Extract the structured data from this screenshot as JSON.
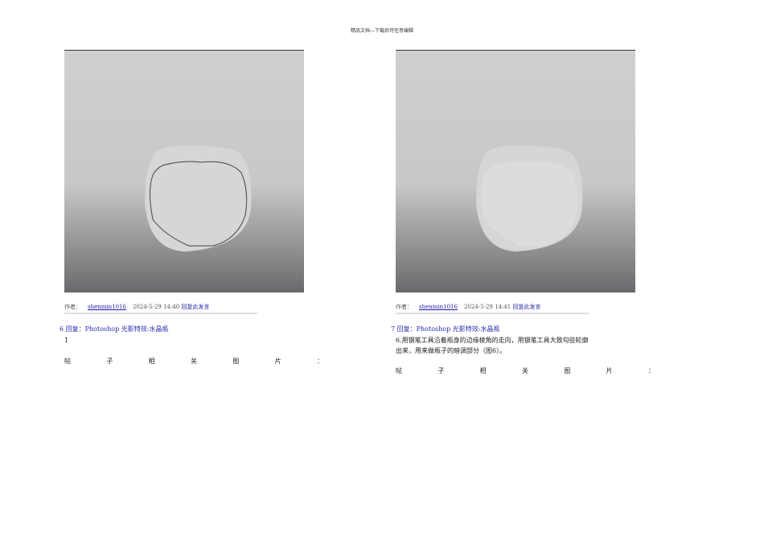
{
  "header": "精品文档---下载后可任意编辑",
  "posts": [
    {
      "author_label": "作者：",
      "author": "shenmin1016",
      "time": "2024-5-29 14:40",
      "reply_link": "回复此发言",
      "num": "6",
      "title": "回复：Photoshop 光影特效:水晶瓶",
      "body": "1",
      "related": [
        "帖",
        "子",
        "相",
        "关",
        "图",
        "片",
        "："
      ]
    },
    {
      "author_label": "作者：",
      "author": "shenmin1016",
      "time": "2024-5-29 14:41",
      "reply_link": "回复此发言",
      "num": "7",
      "title": "回复：Photoshop 光影特效:水晶瓶",
      "body": "6.用钢笔工具沿着瓶身的边缘棱角的走向，用钢笔工具大致勾些轮廓出来，用来做瓶子的暗调部分（图6）。",
      "related": [
        "帖",
        "子",
        "相",
        "关",
        "图",
        "片",
        "："
      ]
    }
  ]
}
